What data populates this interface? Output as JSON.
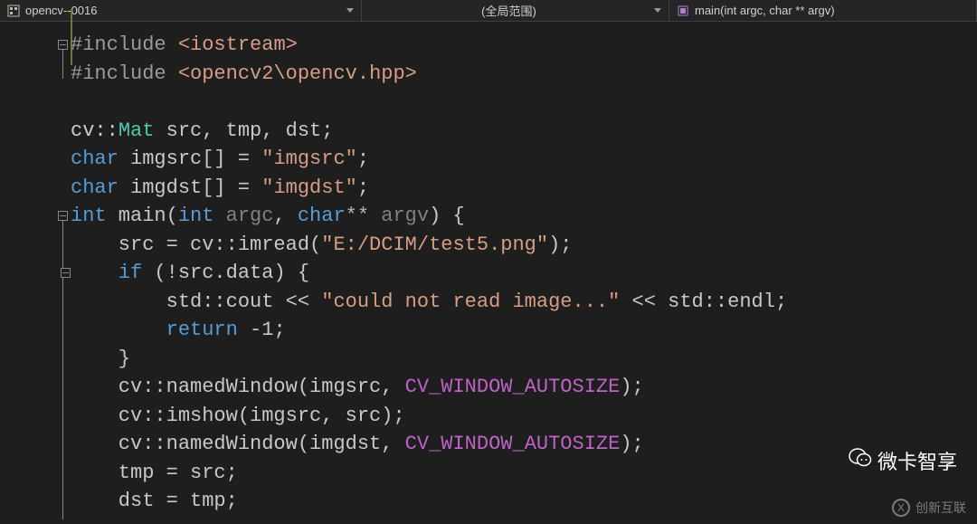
{
  "topbar": {
    "project": "opencv--0016",
    "scope": "(全局范围)",
    "function": "main(int argc, char ** argv)"
  },
  "code": {
    "l1_pp": "#include ",
    "l1_ang": "<iostream>",
    "l2_pp": "#include ",
    "l2_ang": "<opencv2\\opencv.hpp>",
    "l4_ns": "cv::",
    "l4_typ": "Mat",
    "l4_rest": " src, tmp, dst;",
    "l5_kw": "char",
    "l5_id": " imgsrc[] = ",
    "l5_str": "\"imgsrc\"",
    "l5_end": ";",
    "l6_kw": "char",
    "l6_id": " imgdst[] = ",
    "l6_str": "\"imgdst\"",
    "l6_end": ";",
    "l7_kw1": "int",
    "l7_fn": " main(",
    "l7_kw2": "int",
    "l7_p1": " argc",
    "l7_c1": ", ",
    "l7_kw3": "char",
    "l7_st": "**",
    "l7_p2": " argv",
    "l7_close": ") {",
    "l8_pre": "    src = cv::imread(",
    "l8_str": "\"E:/DCIM/test5.png\"",
    "l8_end": ");",
    "l9_pre": "    ",
    "l9_kw": "if",
    "l9_cond": " (!src.data) {",
    "l10_pre": "        std::cout << ",
    "l10_str": "\"could not read image...\"",
    "l10_end": " << std::endl;",
    "l11_pre": "        ",
    "l11_kw": "return",
    "l11_v": " -1;",
    "l12": "    }",
    "l13_pre": "    cv::namedWindow(imgsrc, ",
    "l13_mac": "CV_WINDOW_AUTOSIZE",
    "l13_end": ");",
    "l14": "    cv::imshow(imgsrc, src);",
    "l15_pre": "    cv::namedWindow(imgdst, ",
    "l15_mac": "CV_WINDOW_AUTOSIZE",
    "l15_end": ");",
    "l16": "    tmp = src;",
    "l17": "    dst = tmp;"
  },
  "watermark": {
    "weka": "微卡智享",
    "cx": "创新互联"
  }
}
